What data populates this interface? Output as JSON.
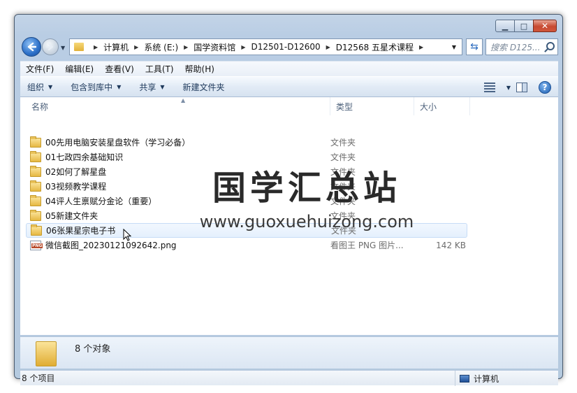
{
  "address": {
    "crumbs": [
      "计算机",
      "系统 (E:)",
      "国学资料馆",
      "D12501-D12600",
      "D12568 五星术课程"
    ]
  },
  "search": {
    "placeholder": "搜索 D125..."
  },
  "menu": [
    "文件(F)",
    "编辑(E)",
    "查看(V)",
    "工具(T)",
    "帮助(H)"
  ],
  "toolbar": {
    "organize": "组织",
    "include_library": "包含到库中",
    "share": "共享",
    "new_folder": "新建文件夹"
  },
  "columns": {
    "name": "名称",
    "type": "类型",
    "size": "大小"
  },
  "files": [
    {
      "name": "00先用电脑安装星盘软件（学习必备）",
      "type": "文件夹",
      "size": "",
      "icon": "folder"
    },
    {
      "name": "01七政四余基础知识",
      "type": "文件夹",
      "size": "",
      "icon": "folder"
    },
    {
      "name": "02如何了解星盘",
      "type": "文件夹",
      "size": "",
      "icon": "folder"
    },
    {
      "name": "03视频教学课程",
      "type": "文件夹",
      "size": "",
      "icon": "folder"
    },
    {
      "name": "04评人生禀赋分金论（重要）",
      "type": "文件夹",
      "size": "",
      "icon": "folder"
    },
    {
      "name": "05新建文件夹",
      "type": "文件夹",
      "size": "",
      "icon": "folder"
    },
    {
      "name": "06张果星宗电子书",
      "type": "文件夹",
      "size": "",
      "icon": "folder"
    },
    {
      "name": "微信截图_20230121092642.png",
      "type": "看图王 PNG 图片...",
      "size": "142 KB",
      "icon": "png"
    }
  ],
  "watermark": {
    "title": "国学汇总站",
    "url": "www.guoxuehuizong.com"
  },
  "details": {
    "text": "8 个对象"
  },
  "status": {
    "left": "8 个项目",
    "right": "计算机"
  },
  "colors": {
    "accent": "#2b6fc8",
    "selection": "#e5f0fd",
    "folder": "#e6b843"
  }
}
